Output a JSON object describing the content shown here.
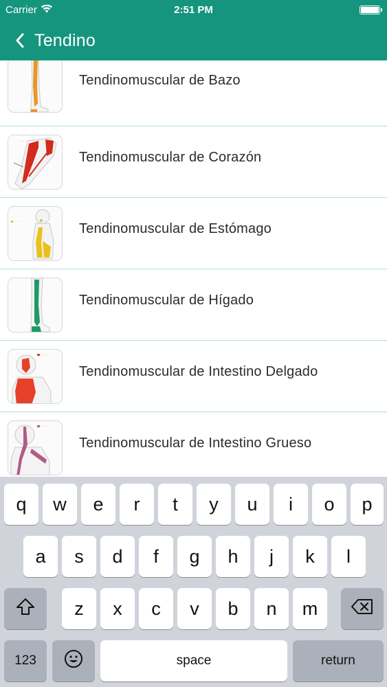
{
  "status_bar": {
    "carrier": "Carrier",
    "time": "2:51 PM",
    "wifi_icon": "wifi-icon",
    "battery_icon": "battery-icon"
  },
  "nav": {
    "back_icon": "chevron-left-icon",
    "title": "Tendino",
    "background": "#16957e"
  },
  "list": {
    "items": [
      {
        "label": "Tendinomuscular de Bazo",
        "thumb": "leg-orange-channel",
        "color": "#e8962a"
      },
      {
        "label": "Tendinomuscular de Corazón",
        "thumb": "arm-red-channel",
        "color": "#d42a1c"
      },
      {
        "label": "Tendinomuscular de Estómago",
        "thumb": "torso-yellow-channel",
        "color": "#e8c21a"
      },
      {
        "label": "Tendinomuscular de Hígado",
        "thumb": "leg-green-channel",
        "color": "#1f9a66"
      },
      {
        "label": "Tendinomuscular de Intestino Delgado",
        "thumb": "back-red-channel",
        "color": "#e6402a"
      },
      {
        "label": "Tendinomuscular de Intestino Grueso",
        "thumb": "back-pink-channel",
        "color": "#b25a86"
      }
    ]
  },
  "keyboard": {
    "row1": [
      "q",
      "w",
      "e",
      "r",
      "t",
      "y",
      "u",
      "i",
      "o",
      "p"
    ],
    "row2": [
      "a",
      "s",
      "d",
      "f",
      "g",
      "h",
      "j",
      "k",
      "l"
    ],
    "row3": [
      "z",
      "x",
      "c",
      "v",
      "b",
      "n",
      "m"
    ],
    "shift_icon": "shift-icon",
    "delete_icon": "backspace-icon",
    "numbers_label": "123",
    "emoji_icon": "emoji-icon",
    "space_label": "space",
    "return_label": "return"
  }
}
